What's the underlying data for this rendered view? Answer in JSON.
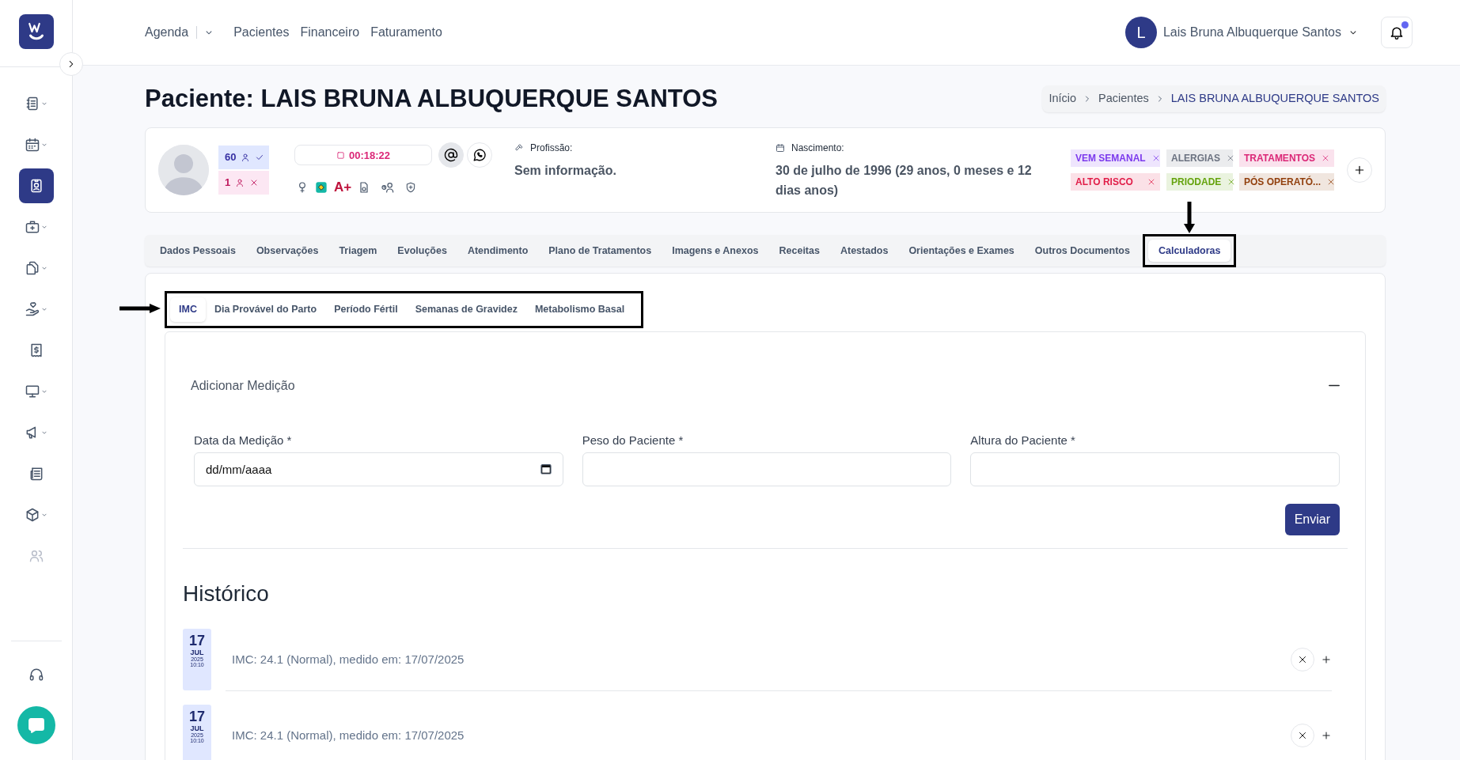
{
  "sidebar": {
    "items": [
      {
        "selected": false,
        "dropdown": true,
        "disabled": false
      },
      {
        "selected": false,
        "dropdown": true,
        "disabled": false
      },
      {
        "selected": true,
        "dropdown": false,
        "disabled": false
      },
      {
        "selected": false,
        "dropdown": true,
        "disabled": false
      },
      {
        "selected": false,
        "dropdown": true,
        "disabled": false
      },
      {
        "selected": false,
        "dropdown": true,
        "disabled": false
      },
      {
        "selected": false,
        "dropdown": false,
        "disabled": false
      },
      {
        "selected": false,
        "dropdown": true,
        "disabled": false
      },
      {
        "selected": false,
        "dropdown": true,
        "disabled": false
      },
      {
        "selected": false,
        "dropdown": false,
        "disabled": false
      },
      {
        "selected": false,
        "dropdown": true,
        "disabled": false
      },
      {
        "selected": false,
        "dropdown": false,
        "disabled": true
      }
    ]
  },
  "topnav": [
    {
      "label": "Agenda",
      "dropdown": true
    },
    {
      "label": "Pacientes",
      "dropdown": false
    },
    {
      "label": "Financeiro",
      "dropdown": false
    },
    {
      "label": "Faturamento",
      "dropdown": false
    }
  ],
  "user": {
    "initial": "L",
    "name": "Lais Bruna Albuquerque Santos",
    "unread": true
  },
  "page_title": "Paciente: LAIS BRUNA ALBUQUERQUE SANTOS",
  "breadcrumb": [
    "Início",
    "Pacientes",
    "LAIS BRUNA ALBUQUERQUE SANTOS"
  ],
  "patient": {
    "counters": [
      {
        "value": "60",
        "kind": "present"
      },
      {
        "value": "1",
        "kind": "absent"
      }
    ],
    "timer": "00:18:22",
    "blood_type": "A+",
    "profession": {
      "label": "Profissão:",
      "value": "Sem informação."
    },
    "birth": {
      "label": "Nascimento:",
      "value": "30 de julho de 1996 (29 anos, 0 meses e 12 dias anos)"
    },
    "tags": [
      {
        "label": "VEM SEMANAL",
        "color": "#7c3aed"
      },
      {
        "label": "ALERGIAS",
        "color": "#6b7280"
      },
      {
        "label": "TRATAMENTOS",
        "color": "#db2777"
      },
      {
        "label": "ALTO RISCO",
        "color": "#e11d48"
      },
      {
        "label": "PRIODADE",
        "color": "#65a30d"
      },
      {
        "label": "PÓS OPERATÓ...",
        "color": "#92400e"
      }
    ]
  },
  "tabs": [
    {
      "label": "Dados Pessoais",
      "selected": false
    },
    {
      "label": "Observações",
      "selected": false
    },
    {
      "label": "Triagem",
      "selected": false
    },
    {
      "label": "Evoluções",
      "selected": false
    },
    {
      "label": "Atendimento",
      "selected": false
    },
    {
      "label": "Plano de Tratamentos",
      "selected": false
    },
    {
      "label": "Imagens e Anexos",
      "selected": false
    },
    {
      "label": "Receitas",
      "selected": false
    },
    {
      "label": "Atestados",
      "selected": false
    },
    {
      "label": "Orientações e Exames",
      "selected": false
    },
    {
      "label": "Outros Documentos",
      "selected": false
    },
    {
      "label": "Calculadoras",
      "selected": true
    }
  ],
  "subtabs": [
    {
      "label": "IMC",
      "selected": true
    },
    {
      "label": "Dia Provável do Parto",
      "selected": false
    },
    {
      "label": "Período Fértil",
      "selected": false
    },
    {
      "label": "Semanas de Gravidez",
      "selected": false
    },
    {
      "label": "Metabolismo Basal",
      "selected": false
    }
  ],
  "form": {
    "title": "Adicionar Medição",
    "expanded": true,
    "fields": [
      {
        "label": "Data da Medição *",
        "kind": "date",
        "placeholder": "dd/mm/aaaa"
      },
      {
        "label": "Peso do Paciente *",
        "kind": "text"
      },
      {
        "label": "Altura do Paciente *",
        "kind": "text"
      }
    ],
    "submit": "Enviar"
  },
  "history": {
    "title": "Histórico",
    "entries": [
      {
        "day": "17",
        "month": "JUL",
        "year": "2025",
        "time": "10:10",
        "text": "IMC: 24.1 (Normal), medido em: 17/07/2025"
      },
      {
        "day": "17",
        "month": "JUL",
        "year": "2025",
        "time": "10:10",
        "text": "IMC: 24.1 (Normal), medido em: 17/07/2025"
      }
    ]
  }
}
